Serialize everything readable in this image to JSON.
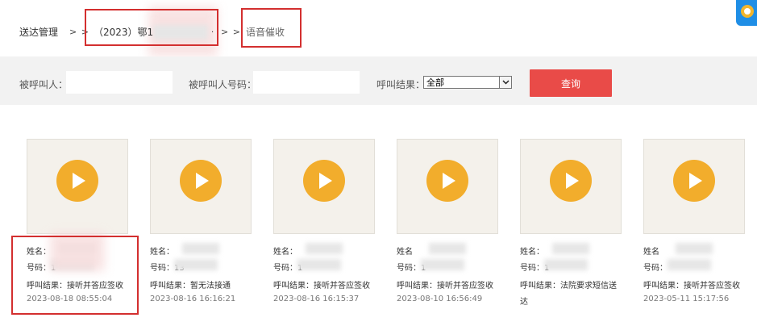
{
  "breadcrumb": {
    "root": "送达管理",
    "sep1": "> >",
    "case": "（2023）鄂1",
    "sep2": "> >",
    "current": "语音催收"
  },
  "filters": {
    "caller_label": "被呼叫人：",
    "number_label": "被呼叫人号码：",
    "result_label": "呼叫结果：",
    "result_value": "全部",
    "query_button": "查询"
  },
  "cards": [
    {
      "name": "姓名：",
      "phone": "号码：1",
      "result": "呼叫结果：接听并答应签收",
      "time": "2023-08-18 08:55:04",
      "result2": ""
    },
    {
      "name": "姓名：",
      "phone": "号码：13",
      "result": "呼叫结果：暂无法接通",
      "time": "2023-08-16 16:16:21",
      "result2": ""
    },
    {
      "name": "姓名：",
      "phone": "号码：1",
      "result": "呼叫结果：接听并答应签收",
      "time": "2023-08-16 16:15:37",
      "result2": ""
    },
    {
      "name": "姓名",
      "phone": "号码：1",
      "result": "呼叫结果：接听并答应签收",
      "time": "2023-08-10 16:56:49",
      "result2": ""
    },
    {
      "name": "姓名：",
      "phone": "号码：1",
      "result": "呼叫结果：法院要求短信送",
      "time": "",
      "result2": "达"
    },
    {
      "name": "姓名",
      "phone": "号码：",
      "result": "呼叫结果：接听并答应签收",
      "time": "2023-05-11 15:17:56",
      "result2": ""
    }
  ]
}
